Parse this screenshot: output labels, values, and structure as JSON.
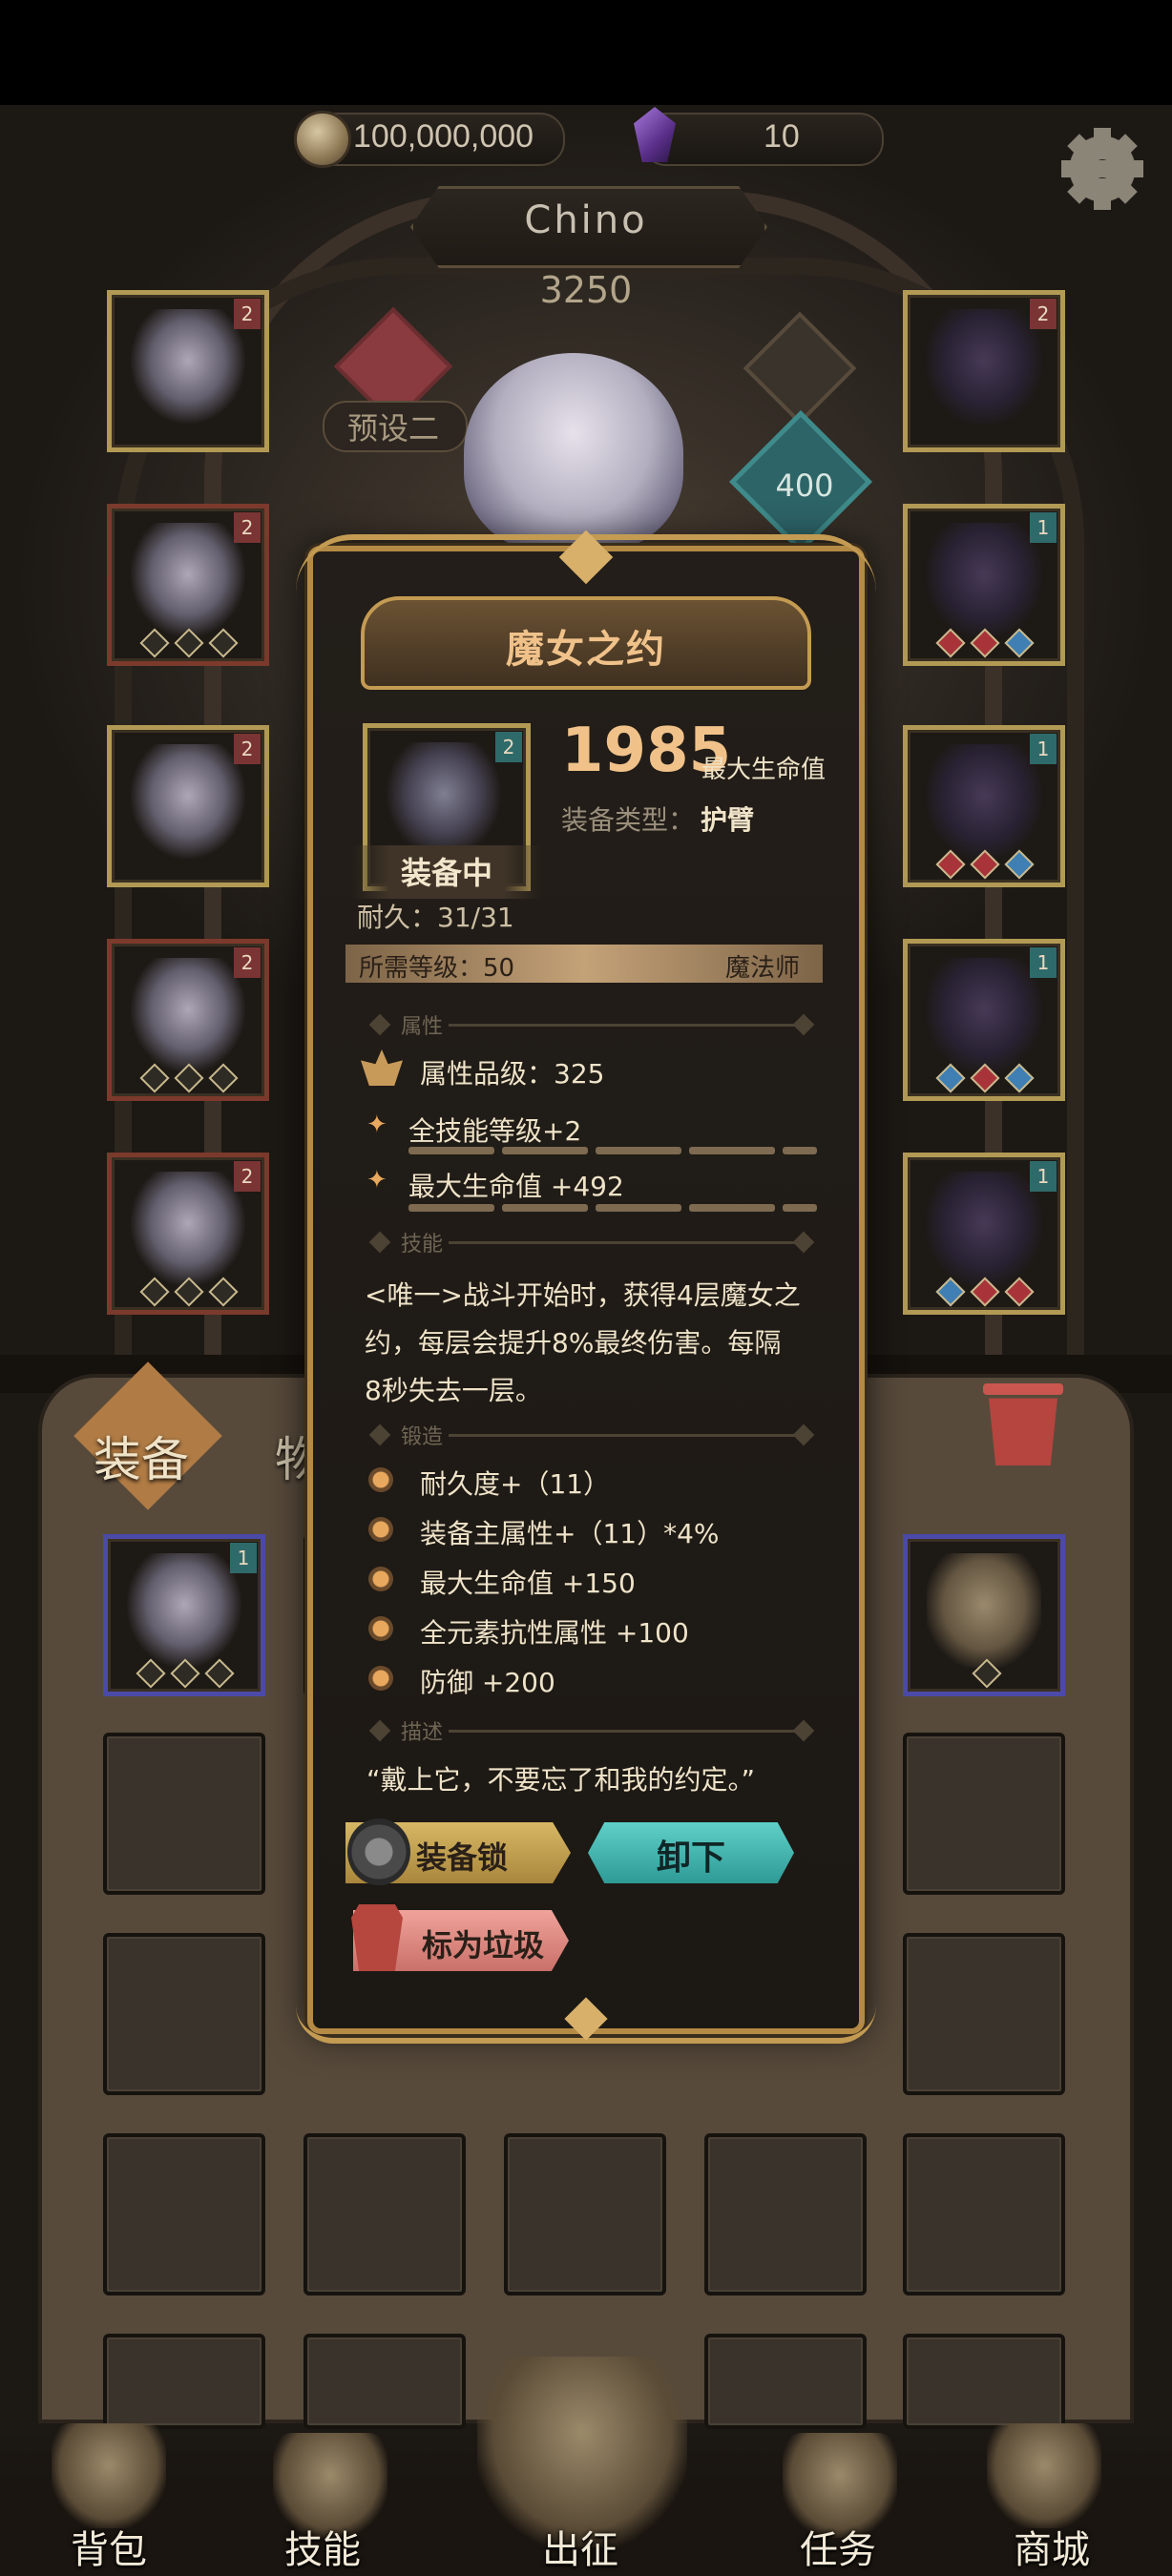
{
  "currency": {
    "gold": "100,000,000",
    "gems": "10"
  },
  "character": {
    "name": "Chino",
    "power": "3250",
    "preset": "预设二",
    "rank_value": "400"
  },
  "equipment_slots": {
    "left_tags": [
      "2",
      "2",
      "2",
      "2",
      "2"
    ],
    "right_tags": [
      "2",
      "1",
      "1",
      "1",
      "1"
    ],
    "bag_first_tag": "1"
  },
  "tabs": {
    "equipment": "装备",
    "items": "物品"
  },
  "popup": {
    "title": "魔女之约",
    "item_tag": "2",
    "main_value": "1985",
    "main_stat_name": "最大生命值",
    "equip_type_label": "装备类型：",
    "equip_type_value": "护臂",
    "equipped_label": "装备中",
    "durability": "耐久：31/31",
    "required_level": "所需等级：50",
    "class": "魔法师",
    "sections": {
      "attributes": "属性",
      "skill": "技能",
      "forge": "锻造",
      "description": "描述"
    },
    "attribute_quality": "属性品级：325",
    "attributes": [
      "全技能等级+2",
      "最大生命值 +492"
    ],
    "skill_text": [
      "<唯一>战斗开始时，获得4层魔女之",
      "约，每层会提升8%最终伤害。每隔",
      "8秒失去一层。"
    ],
    "forge_list": [
      "耐久度+（11）",
      "装备主属性+（11）*4%",
      "最大生命值 +150",
      "全元素抗性属性 +100",
      "防御 +200"
    ],
    "description": "“戴上它，不要忘了和我的约定。”",
    "buttons": {
      "lock": "装备锁",
      "unequip": "卸下",
      "mark_junk": "标为垃圾"
    }
  },
  "bottom_nav": [
    "背包",
    "技能",
    "出征",
    "任务",
    "商城"
  ],
  "colors": {
    "gold_border": "#b29a55",
    "title_text": "#f0c28a",
    "unequip_btn": "#3fb3b0",
    "junk_btn": "#e08c84",
    "lock_btn": "#c9a552"
  }
}
